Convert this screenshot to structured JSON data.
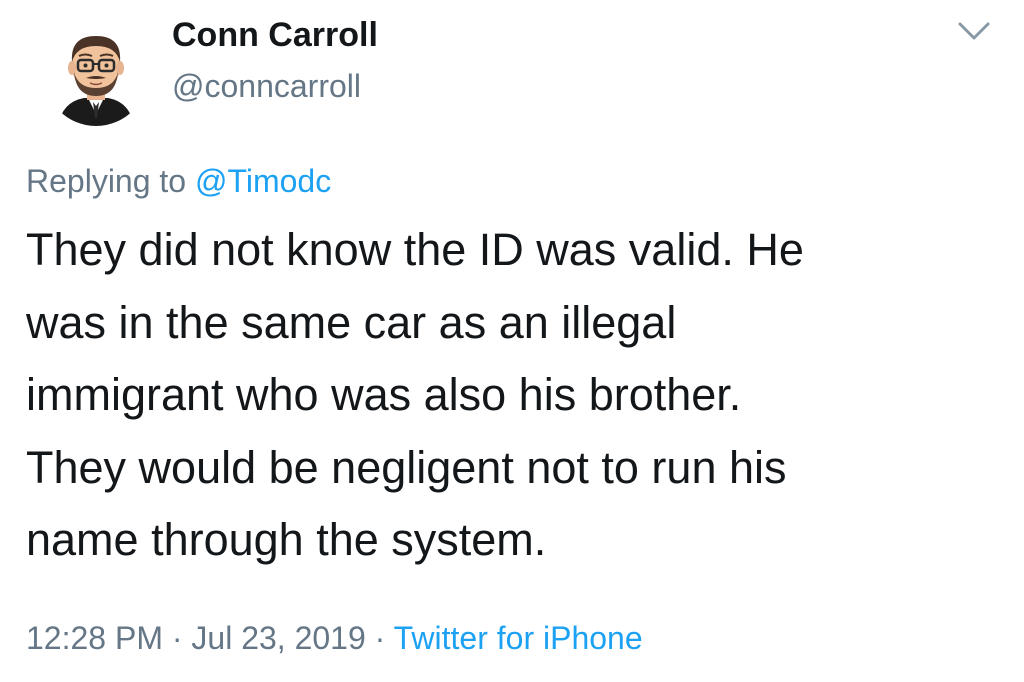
{
  "author": {
    "display_name": "Conn Carroll",
    "handle": "@conncarroll",
    "avatar_icon": "bitmoji-avatar-icon"
  },
  "menu_icon": "chevron-down-icon",
  "reply": {
    "prefix": "Replying to ",
    "mention": "@Timodc"
  },
  "tweet": {
    "lines": [
      "They did not know the ID was valid. He",
      "was in the same car as an illegal",
      "immigrant who was also his brother.",
      "They would be negligent not to run his",
      "name through the system."
    ]
  },
  "meta": {
    "time": "12:28 PM",
    "separator": " · ",
    "date": "Jul 23, 2019",
    "source": "Twitter for iPhone"
  },
  "colors": {
    "text_primary": "#14171a",
    "text_secondary": "#657786",
    "link": "#1da1f2",
    "background": "#ffffff"
  }
}
